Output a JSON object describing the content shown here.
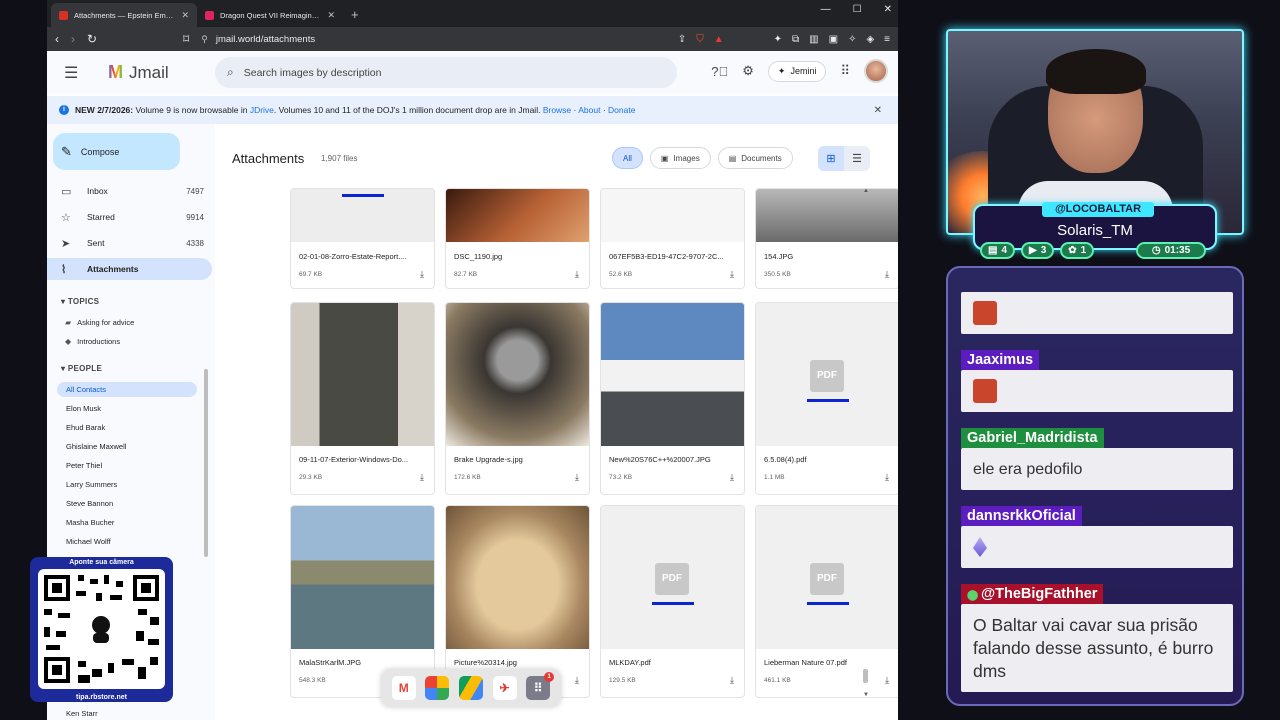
{
  "browser": {
    "tabs": [
      {
        "title": "Attachments — Epstein Emails",
        "active": true
      },
      {
        "title": "Dragon Quest VII Reimagined | Xsolla Partne",
        "active": false
      }
    ],
    "url": "jmail.world/attachments",
    "ext_badge": "1"
  },
  "header": {
    "app_name": "Jmail",
    "search_placeholder": "Search images by description",
    "assistant_label": "Jemini"
  },
  "banner": {
    "prefix": "NEW 2/7/2026:",
    "text_1": " Volume 9 is now browsable in ",
    "link_jdrive": "JDrive",
    "text_2": ". Volumes 10 and 11 of the DOJ's 1 million document drop are in Jmail. ",
    "link_browse": "Browse",
    "sep": " · ",
    "link_about": "About",
    "link_donate": "Donate"
  },
  "sidebar": {
    "compose_label": "Compose",
    "nav": [
      {
        "label": "Inbox",
        "count": "7497",
        "icon": "inbox-icon"
      },
      {
        "label": "Starred",
        "count": "9914",
        "icon": "star-icon"
      },
      {
        "label": "Sent",
        "count": "4338",
        "icon": "send-icon"
      },
      {
        "label": "Attachments",
        "count": "",
        "icon": "paperclip-icon"
      }
    ],
    "topics_header": "TOPICS",
    "topics": [
      "Asking for advice",
      "Introductions"
    ],
    "people_header": "PEOPLE",
    "people": [
      "All Contacts",
      "Elon Musk",
      "Ehud Barak",
      "Ghislaine Maxwell",
      "Peter Thiel",
      "Larry Summers",
      "Steve Bannon",
      "Masha Bucher",
      "Michael Wolff",
      "Ken Starr"
    ]
  },
  "main": {
    "title": "Attachments",
    "count": "1,907 files",
    "filters": [
      {
        "label": "All",
        "selected": true
      },
      {
        "label": "Images",
        "selected": false
      },
      {
        "label": "Documents",
        "selected": false
      }
    ],
    "files": [
      {
        "name": "02-01-08-Zorro-Estate-Report....",
        "size": "69.7 KB",
        "kind": "image",
        "thumb": "#ededed"
      },
      {
        "name": "DSC_1190.jpg",
        "size": "82.7 KB",
        "kind": "image",
        "thumb": "#8a4a2c"
      },
      {
        "name": "067EF5B3-ED19-47C2-9707-2C...",
        "size": "52.6 KB",
        "kind": "image",
        "thumb": "#f6f6f6"
      },
      {
        "name": "154.JPG",
        "size": "350.5 KB",
        "kind": "image",
        "thumb": "#9a9a9a"
      },
      {
        "name": "09-11-07-Exterior-Windows-Do...",
        "size": "29.3 KB",
        "kind": "image",
        "thumb": "#6e6a60"
      },
      {
        "name": "Brake Upgrade-s.jpg",
        "size": "172.6 KB",
        "kind": "image",
        "thumb": "#5f5850"
      },
      {
        "name": "New%20S76C++%20007.JPG",
        "size": "73.2 KB",
        "kind": "image",
        "thumb": "#7f9fc4"
      },
      {
        "name": "6.5.08(4).pdf",
        "size": "1.1 MB",
        "kind": "pdf",
        "thumb": "#f0f0f0"
      },
      {
        "name": "MalaStrKarlM.JPG",
        "size": "548.3 KB",
        "kind": "image",
        "thumb": "#8fa8b0"
      },
      {
        "name": "Picture%20314.jpg",
        "size": "",
        "kind": "image",
        "thumb": "#c9ab7e"
      },
      {
        "name": "MLKDAY.pdf",
        "size": "129.5 KB",
        "kind": "pdf",
        "thumb": "#f0f0f0"
      },
      {
        "name": "Lieberman Nature 07.pdf",
        "size": "461.1 KB",
        "kind": "pdf",
        "thumb": "#f0f0f0"
      }
    ],
    "pdf_label": "PDF"
  },
  "dock": {
    "badge": "1"
  },
  "qr": {
    "top_text": "Aponte sua câmera",
    "bottom_text": "tipa.rbstore.net"
  },
  "stream": {
    "handle": "@LOCOBALTAR",
    "display_name": "Solaris_TM",
    "stats": [
      {
        "icon": "chat-icon",
        "value": "4"
      },
      {
        "icon": "video-icon",
        "value": "3"
      },
      {
        "icon": "gift-icon",
        "value": "1"
      }
    ],
    "timer": "01:35",
    "chat": [
      {
        "user": "",
        "text": "",
        "type": "emoji",
        "color": "#5b1dc0"
      },
      {
        "user": "Jaaximus",
        "text": "",
        "type": "emoji",
        "color": "#5b1dc0"
      },
      {
        "user": "Gabriel_Madridista",
        "text": "ele era pedofilo",
        "type": "text",
        "color": "#1e8f3e"
      },
      {
        "user": "dannsrkkOficial",
        "text": "",
        "type": "gem",
        "color": "#5b1dc0"
      },
      {
        "user": "@TheBigFathher",
        "text": "O Baltar vai cavar sua prisão falando desse assunto, é burro dms",
        "type": "text",
        "color": "#a8102b"
      }
    ]
  },
  "colors": {
    "accent": "#0b57d0",
    "compose_bg": "#c2e7ff",
    "selected_bg": "#d3e3fd",
    "overlay_cyan": "#3ee6ff"
  }
}
